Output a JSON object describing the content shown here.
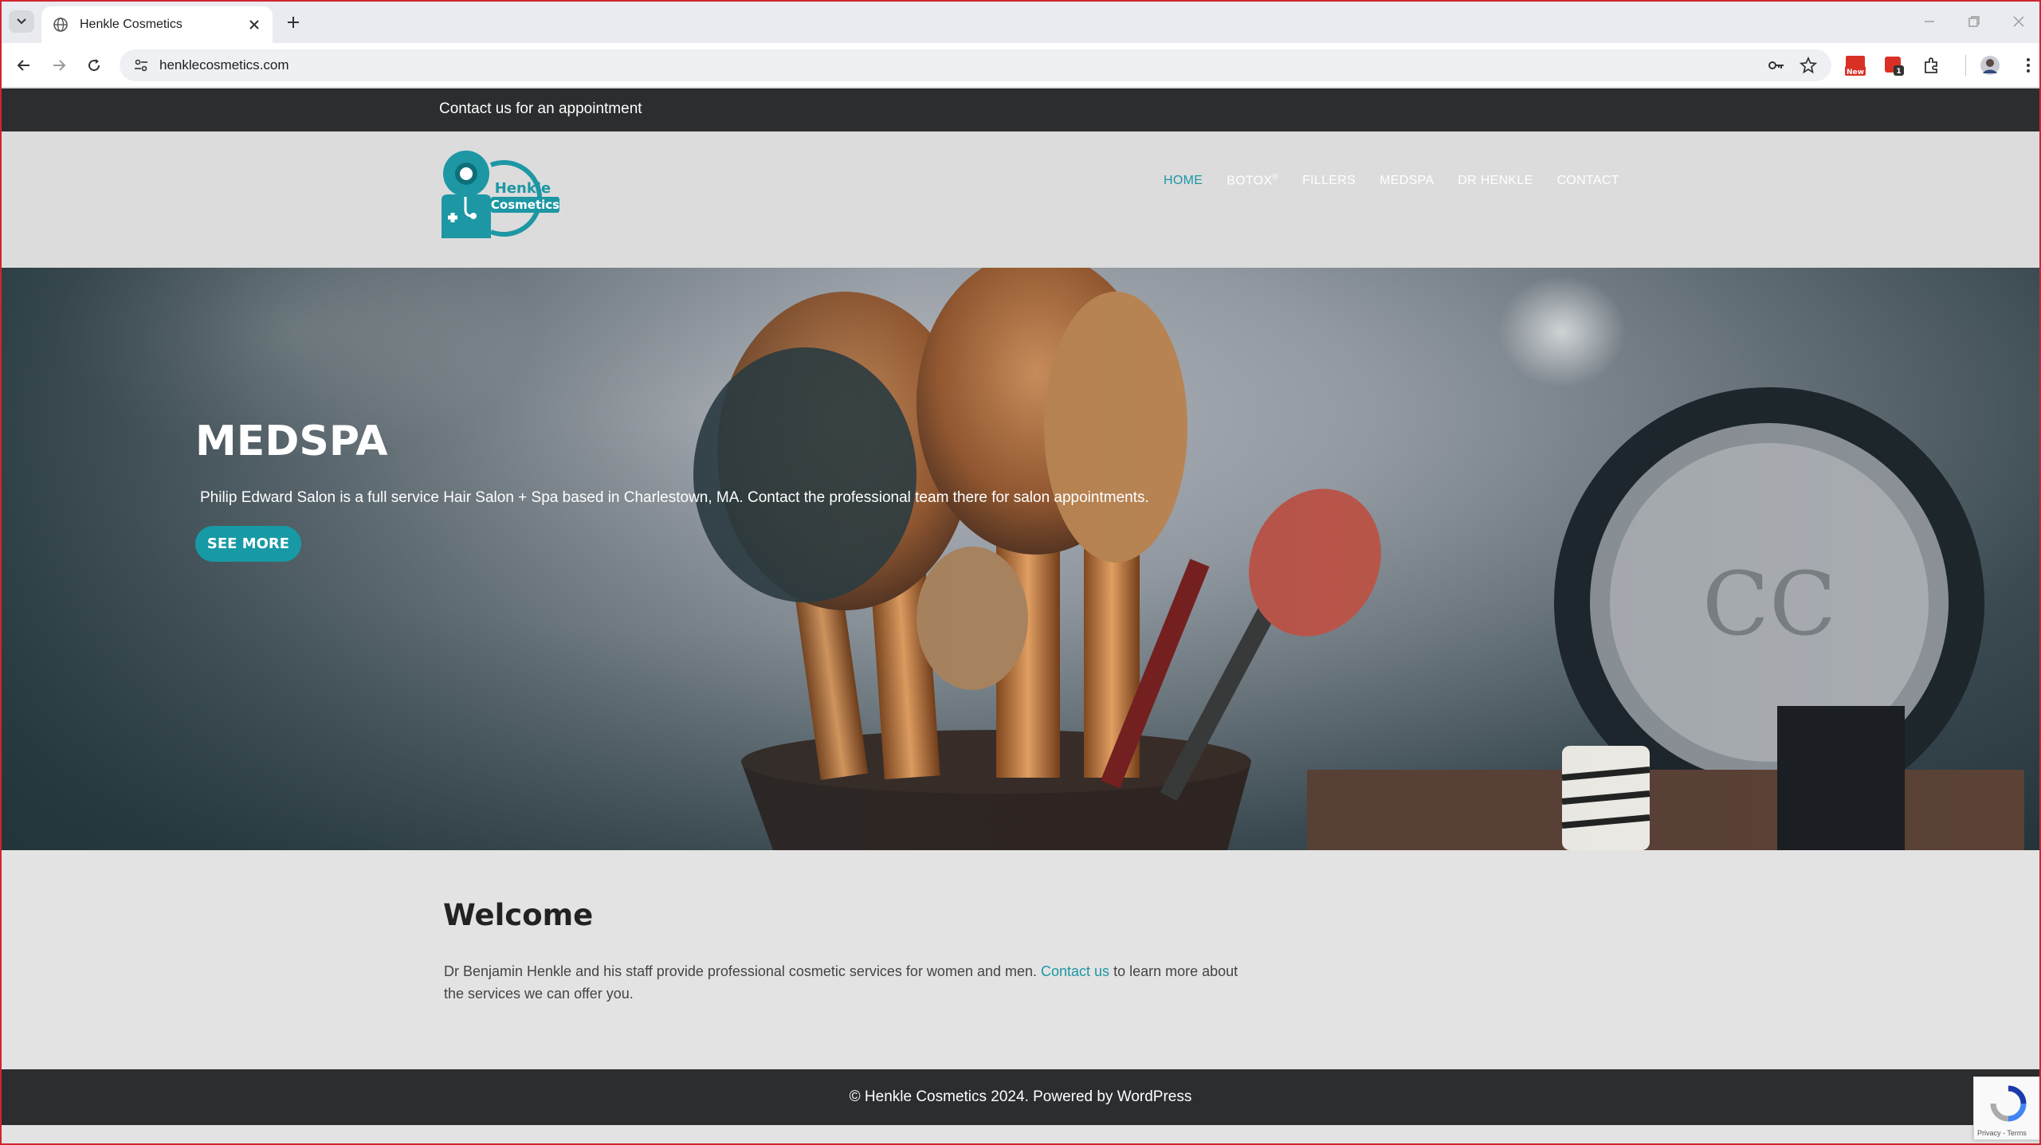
{
  "browser": {
    "tab_title": "Henkle Cosmetics",
    "url": "henklecosmetics.com",
    "ext_badge_new": "New",
    "ext_badge_count": "1"
  },
  "page": {
    "topbar_text": "Contact us for an appointment",
    "logo": {
      "line1": "Henkle",
      "line2": "Cosmetics"
    },
    "nav": [
      {
        "label": "HOME",
        "active": true
      },
      {
        "label": "BOTOX",
        "sup": "®"
      },
      {
        "label": "FILLERS"
      },
      {
        "label": "MEDSPA"
      },
      {
        "label": "DR HENKLE"
      },
      {
        "label": "CONTACT"
      }
    ],
    "hero": {
      "title": "MEDSPA",
      "text": "Philip Edward Salon is a full service Hair Salon + Spa based in Charlestown, MA. Contact the professional team there for salon appointments.",
      "button": "SEE MORE"
    },
    "welcome": {
      "title": "Welcome",
      "body_before": "Dr Benjamin Henkle and his staff provide professional cosmetic services for women and men. ",
      "link": "Contact us",
      "body_after": " to learn more about the services we can offer you."
    },
    "footer": "© Henkle Cosmetics 2024. Powered by WordPress",
    "recaptcha": "Privacy - Terms"
  },
  "colors": {
    "accent": "#1d97a4",
    "dark_bar": "#2b2d2f",
    "header_bg": "#dcdcdc"
  }
}
